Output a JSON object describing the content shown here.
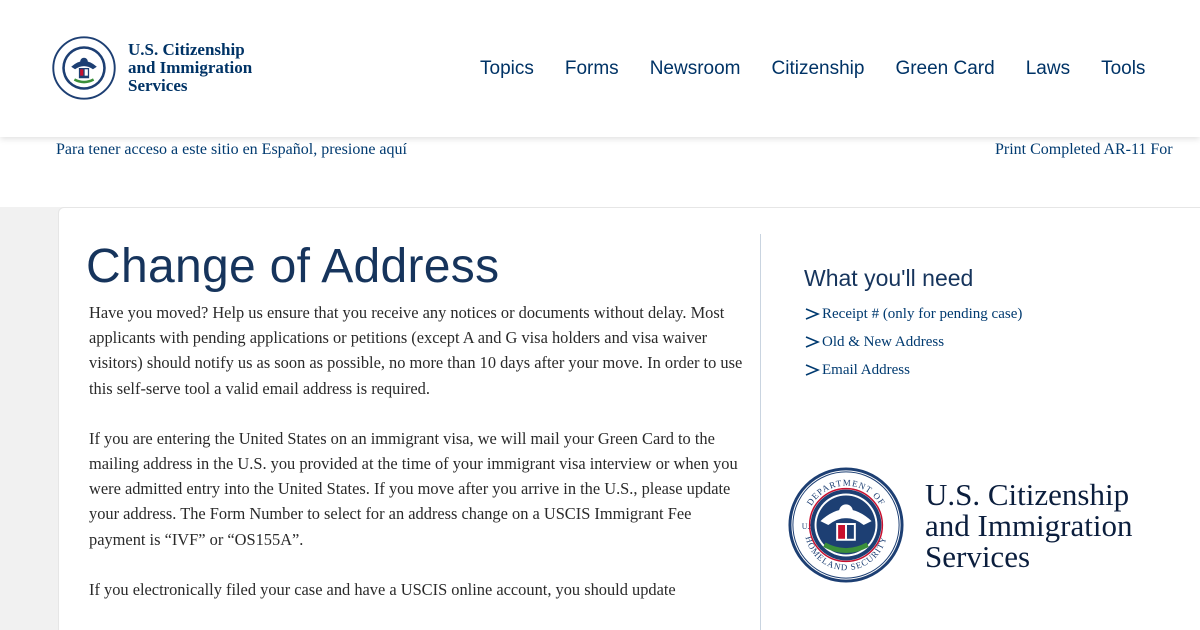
{
  "header": {
    "logo": {
      "line1": "U.S. Citizenship",
      "line2": "and Immigration",
      "line3": "Services"
    },
    "nav": [
      {
        "label": "Topics"
      },
      {
        "label": "Forms"
      },
      {
        "label": "Newsroom"
      },
      {
        "label": "Citizenship"
      },
      {
        "label": "Green Card"
      },
      {
        "label": "Laws"
      },
      {
        "label": "Tools"
      }
    ]
  },
  "subbar": {
    "spanish_link": "Para tener acceso a este sitio en Español, presione aquí",
    "print_link": "Print Completed AR-11 For"
  },
  "main": {
    "title": "Change of Address",
    "paragraphs": [
      "Have you moved? Help us ensure that you receive any notices or documents without delay. Most applicants with pending applications or petitions (except A and G visa holders and visa waiver visitors) should notify us as soon as possible, no more than 10 days after your move. In order to use this self-serve tool a valid email address is required.",
      "If you are entering the United States on an immigrant visa, we will mail your Green Card to the mailing address in the U.S. you provided at the time of your immigrant visa interview or when you were admitted entry into the United States. If you move after you arrive in the U.S., please update your address. The Form Number to select for an address change on a USCIS Immigrant Fee payment is “IVF” or “OS155A”.",
      "If you electronically filed your case and have a USCIS online account, you should update"
    ]
  },
  "sidebar": {
    "heading": "What you'll need",
    "items": [
      {
        "label": "Receipt # (only for pending case)"
      },
      {
        "label": "Old & New Address"
      },
      {
        "label": "Email Address"
      }
    ],
    "logo": {
      "line1": "U.S. Citizenship",
      "line2": "and Immigration",
      "line3": "Services"
    },
    "seal_text": {
      "top": "DEPARTMENT OF",
      "bottom": "HOMELAND SECURITY",
      "left": "U.S."
    }
  },
  "colors": {
    "brand": "#003366",
    "link": "#003a70",
    "title": "#16345c"
  },
  "icons": {
    "seal": "dhs-seal-icon",
    "chevron": "chevron-right-icon"
  }
}
